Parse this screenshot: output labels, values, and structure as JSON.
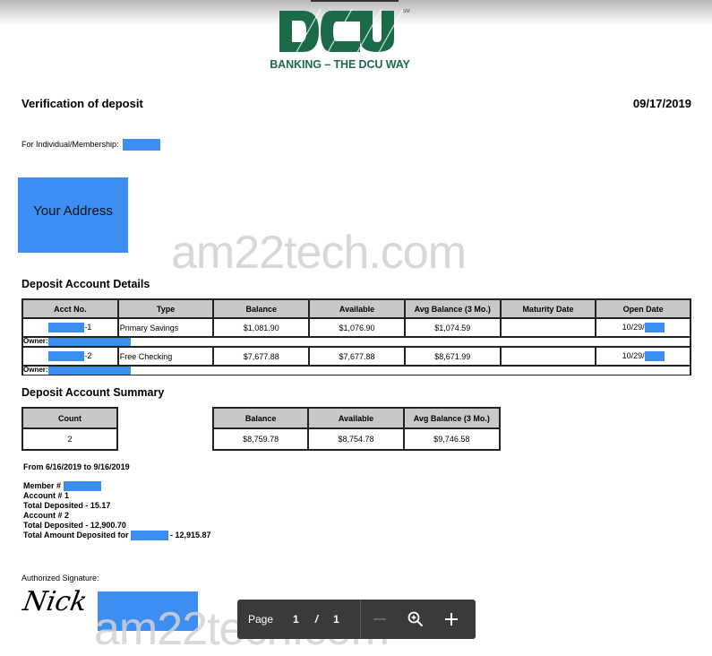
{
  "logo": {
    "brand": "DCU",
    "service_mark": "SM",
    "tagline": "BANKING – THE DCU WAY",
    "brand_color": "#1b6b49"
  },
  "header": {
    "title": "Verification of deposit",
    "date": "09/17/2019",
    "membership_label": "For Individual/Membership:"
  },
  "address_box": {
    "label": "Your Address",
    "color": "#3d8ef3"
  },
  "watermark": "am22tech.com",
  "details": {
    "title": "Deposit Account Details",
    "columns": [
      "Acct No.",
      "Type",
      "Balance",
      "Available",
      "Avg Balance (3 Mo.)",
      "Maturity Date",
      "Open Date"
    ],
    "rows": [
      {
        "acct_suffix": "-1",
        "type": "Primary Savings",
        "balance": "$1,081.90",
        "available": "$1,076.90",
        "avg_balance": "$1,074.59",
        "maturity": "",
        "open_date": "10/29/",
        "owner_label": "Owner:"
      },
      {
        "acct_suffix": "-2",
        "type": "Free Checking",
        "balance": "$7,677.88",
        "available": "$7,677.88",
        "avg_balance": "$8,671.99",
        "maturity": "",
        "open_date": "10/29/",
        "owner_label": "Owner:"
      }
    ]
  },
  "summary": {
    "title": "Deposit Account Summary",
    "count_header": "Count",
    "count": "2",
    "columns": [
      "Balance",
      "Available",
      "Avg Balance (3 Mo.)"
    ],
    "values": [
      "$8,759.78",
      "$8,754.78",
      "$9,746.58"
    ]
  },
  "deposits": {
    "period": "From 6/16/2019 to 9/16/2019",
    "member_label": "Member #",
    "account1": "Account # 1",
    "total1": "Total Deposited - 15.17",
    "account2": "Account # 2",
    "total2": "Total Deposited - 12,900.70",
    "grand_total_label": "Total Amount Deposited for",
    "grand_total_value": "- 12,915.87"
  },
  "signature": {
    "label": "Authorized Signature:",
    "name": "Nick"
  },
  "viewer_toolbar": {
    "page_label": "Page",
    "current_page": "1",
    "separator": "/",
    "total_pages": "1"
  }
}
